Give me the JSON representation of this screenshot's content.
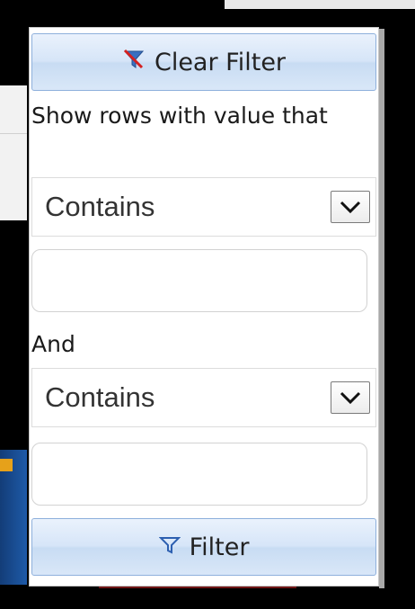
{
  "filter_popup": {
    "clear_filter_label": "Clear Filter",
    "show_rows_label": "Show rows with value that",
    "condition_1": {
      "selected": "Contains",
      "value": ""
    },
    "conjunction_label": "And",
    "condition_2": {
      "selected": "Contains",
      "value": ""
    },
    "filter_button_label": "Filter"
  },
  "icons": {
    "clear_filter": "clear-filter-icon",
    "filter": "filter-icon",
    "dropdown": "chevron-down-icon"
  },
  "colors": {
    "button_border": "#8eb0dc",
    "button_bg": "#d6e5f8",
    "clear_icon_red": "#d42020",
    "filter_icon_blue": "#2c5fb0"
  }
}
